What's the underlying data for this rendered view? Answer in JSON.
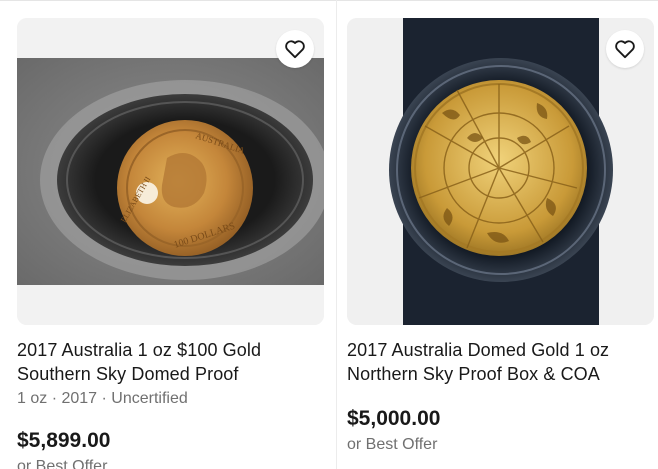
{
  "listings": [
    {
      "title_line1": "2017 Australia 1 oz $100 Gold",
      "title_line2": "Southern Sky Domed Proof",
      "subtitle": "1 oz · 2017 · Uncertified",
      "price": "$5,899.00",
      "offer": "or Best Offer",
      "image": "gold-coin-southern-sky-photo",
      "coin_inscription_top": "AUSTRALIA",
      "coin_inscription_bottom": "100 DOLLARS",
      "coin_inscription_left": "ELIZABETH II"
    },
    {
      "title_line1": "2017 Australia Domed Gold 1 oz",
      "title_line2": "Northern Sky Proof Box & COA",
      "price": "$5,000.00",
      "offer": "or Best Offer",
      "image": "gold-coin-northern-sky-photo"
    }
  ],
  "icons": {
    "watch": "heart-icon"
  },
  "colors": {
    "text": "#191919",
    "secondary": "#707070",
    "gold": "#c9a24a"
  }
}
